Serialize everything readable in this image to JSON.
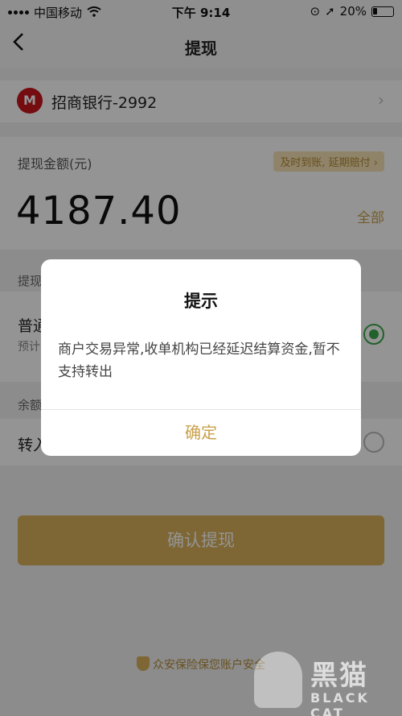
{
  "status_bar": {
    "carrier": "中国移动",
    "time": "下午 9:14",
    "battery": "20%"
  },
  "nav": {
    "title": "提现"
  },
  "bank": {
    "logo_text": "M",
    "name": "招商银行-2992"
  },
  "amount": {
    "label": "提现金额(元)",
    "badge": "及时到账, 延期赔付 ›",
    "value": "4187.40",
    "all": "全部"
  },
  "method": {
    "section_label": "提现",
    "title": "普通",
    "subtitle": "预计"
  },
  "transfer": {
    "section_label": "余额",
    "title": "转入"
  },
  "confirm_button": "确认提现",
  "insurance": "众安保险保您账户安全",
  "watermark": {
    "text": "黑猫",
    "sub": "BLACK CAT"
  },
  "dialog": {
    "title": "提示",
    "message": "商户交易异常,收单机构已经延迟结算资金,暂不支持转出",
    "ok": "确定"
  },
  "colors": {
    "accent": "#d9b15a",
    "radio_selected": "#3aa94a",
    "bank_logo": "#c8161d"
  }
}
